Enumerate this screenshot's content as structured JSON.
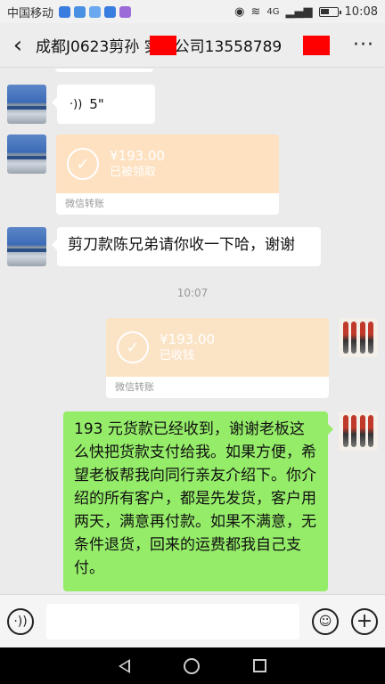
{
  "status_bar": {
    "carrier": "中国移动",
    "network": "4G",
    "time": "10:08"
  },
  "header": {
    "title": "成都J0623剪孙  实…公司13558789",
    "more": "···"
  },
  "messages": {
    "voice": {
      "duration": "5\""
    },
    "transfer_in": {
      "amount": "¥193.00",
      "status": "已被领取",
      "footer": "微信转账"
    },
    "text_in": "剪刀款陈兄弟请你收一下哈，谢谢",
    "timestamp": "10:07",
    "transfer_out": {
      "amount": "¥193.00",
      "status": "已收钱",
      "footer": "微信转账"
    },
    "text_out": "193 元货款已经收到，谢谢老板这么快把货款支付给我。如果方便，希望老板帮我向同行亲友介绍下。你介绍的所有客户，都是先发货，客户用两天，满意再付款。如果不满意，无条件退货，回来的运费都我自己支付。"
  },
  "colors": {
    "bubble_out": "#95ec69",
    "transfer_bg": "#fde1c1",
    "chat_bg": "#ebebeb"
  }
}
